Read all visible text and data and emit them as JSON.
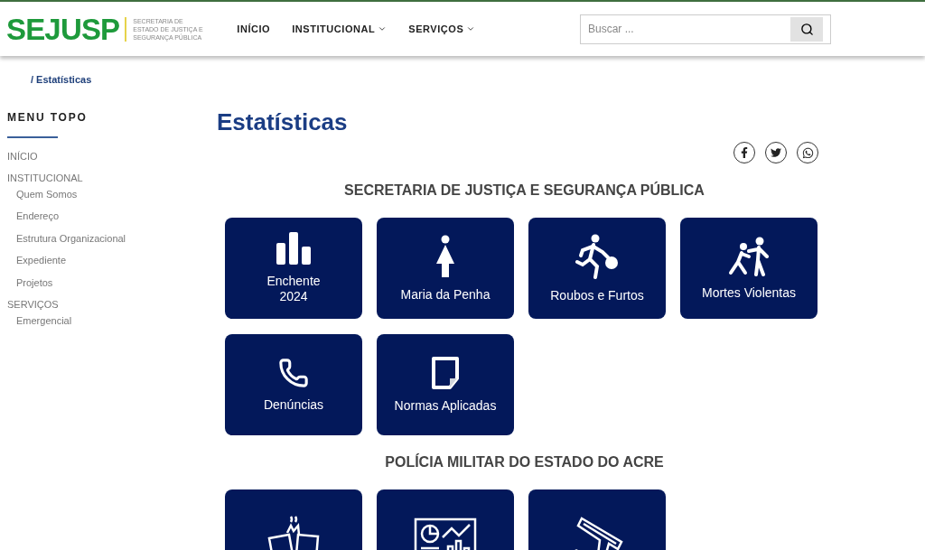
{
  "header": {
    "logo": "SEJUSP",
    "tagline": "SECRETARIA DE ESTADO DE JUSTIÇA E SEGURANÇA PÚBLICA",
    "nav": [
      {
        "label": "INÍCIO",
        "has_menu": false
      },
      {
        "label": "INSTITUCIONAL",
        "has_menu": true
      },
      {
        "label": "SERVIÇOS",
        "has_menu": true
      }
    ],
    "search": {
      "placeholder": "Buscar ..."
    }
  },
  "breadcrumb": "/ Estatísticas",
  "sidebar": {
    "title": "MENU TOPO",
    "items": [
      {
        "label": "INÍCIO"
      },
      {
        "label": "INSTITUCIONAL",
        "children": [
          {
            "label": "Quem Somos"
          },
          {
            "label": "Endereço"
          },
          {
            "label": "Estrutura Organizacional"
          },
          {
            "label": "Expediente"
          },
          {
            "label": "Projetos"
          }
        ]
      },
      {
        "label": "SERVIÇOS",
        "children": [
          {
            "label": "Emergencial"
          }
        ]
      }
    ]
  },
  "page_title": "Estatísticas",
  "share_buttons": [
    {
      "kind": "facebook"
    },
    {
      "kind": "twitter"
    },
    {
      "kind": "whatsapp"
    }
  ],
  "sections": [
    {
      "title": "SECRETARIA DE JUSTIÇA E SEGURANÇA PÚBLICA",
      "cards": [
        {
          "kind": "bars",
          "label": "Enchente\n2024"
        },
        {
          "kind": "woman",
          "label": "Maria da Penha"
        },
        {
          "kind": "thief",
          "label": "Roubos e Furtos"
        },
        {
          "kind": "fight",
          "label": "Mortes Violentas"
        },
        {
          "kind": "phone",
          "label": "Denúncias"
        },
        {
          "kind": "document",
          "label": "Normas Aplicadas"
        }
      ]
    },
    {
      "title": "POLÍCIA MILITAR DO ESTADO DO ACRE",
      "cards": [
        {
          "kind": "crash"
        },
        {
          "kind": "dashboard"
        },
        {
          "kind": "gun"
        }
      ]
    }
  ]
}
